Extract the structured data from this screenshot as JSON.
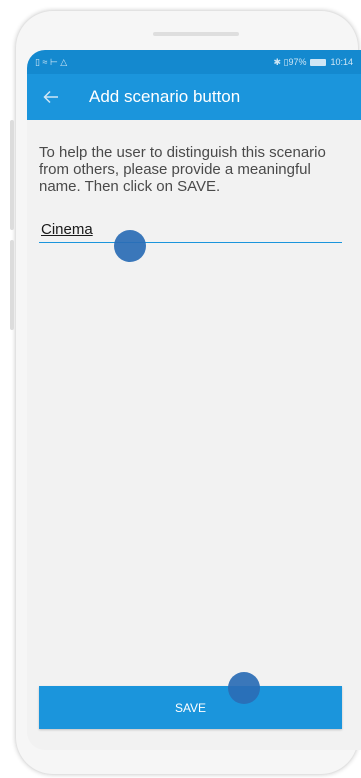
{
  "status_bar": {
    "left_icons": "▯ ≈ ⊢ △",
    "right_text": "✱ ▯97%",
    "time": "10:14"
  },
  "toolbar": {
    "title": "Add scenario button",
    "back_icon": "arrow-left-icon"
  },
  "description": "To help the user to distinguish this scenario from others, please provide a meaningful name. Then click on SAVE.",
  "name_field": {
    "value": "Cinema"
  },
  "save_button": {
    "label": "SAVE"
  },
  "colors": {
    "status_bar": "#1489cf",
    "toolbar": "#1b95dc",
    "accent": "#1b95dc",
    "tap_indicator": "#2a6db5"
  }
}
